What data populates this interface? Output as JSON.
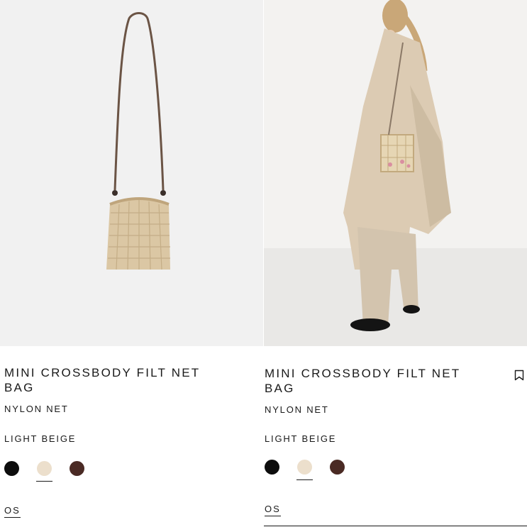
{
  "products": [
    {
      "name": "MINI CROSSBODY FILT NET BAG",
      "material": "NYLON NET",
      "color_name": "LIGHT BEIGE",
      "size": "OS",
      "image_label": "product-bag-only",
      "swatches": [
        {
          "name": "black",
          "color": "#0d0d0d",
          "selected": false
        },
        {
          "name": "light-beige",
          "color": "#ecdfcc",
          "selected": true
        },
        {
          "name": "dark-brown",
          "color": "#4a2a24",
          "selected": false
        }
      ]
    },
    {
      "name": "MINI CROSSBODY FILT NET BAG",
      "material": "NYLON NET",
      "color_name": "LIGHT BEIGE",
      "size": "OS",
      "image_label": "product-model-wearing",
      "bookmark_icon": "bookmark-icon",
      "swatches": [
        {
          "name": "black",
          "color": "#0d0d0d",
          "selected": false
        },
        {
          "name": "light-beige",
          "color": "#ecdfcc",
          "selected": true
        },
        {
          "name": "dark-brown",
          "color": "#4a2a24",
          "selected": false
        }
      ]
    }
  ]
}
